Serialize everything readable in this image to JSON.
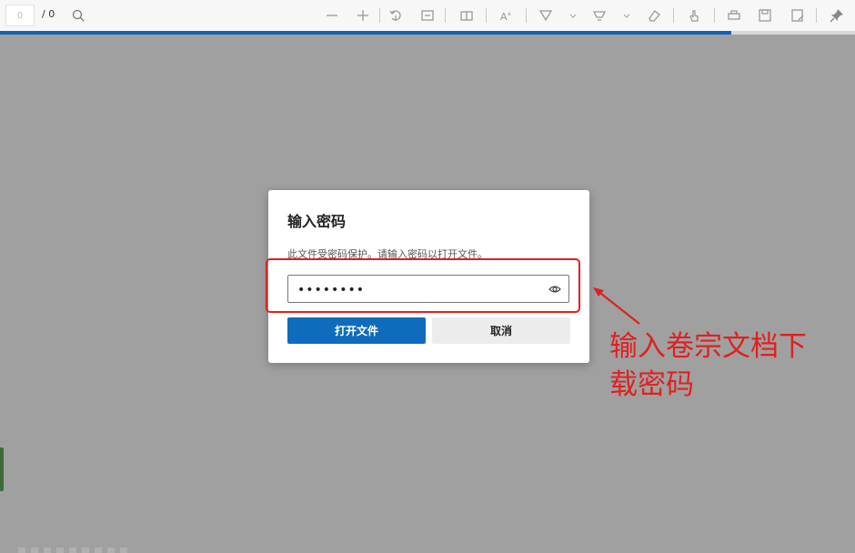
{
  "toolbar": {
    "page_input_value": "0",
    "page_total": "/ 0",
    "icons": [
      "search-icon",
      "zoom-out-icon",
      "zoom-in-icon",
      "rotate-icon",
      "fit-page-icon",
      "page-view-icon",
      "read-aloud-icon",
      "draw-icon",
      "highlight-icon",
      "erase-icon",
      "touch-icon",
      "print-icon",
      "save-icon",
      "save-as-icon",
      "pin-icon"
    ]
  },
  "load_progress_percent": 85.5,
  "dialog": {
    "title": "输入密码",
    "description": "此文件受密码保护。请输入密码以打开文件。",
    "password_value": "••••••••",
    "open_button": "打开文件",
    "cancel_button": "取消"
  },
  "annotation": {
    "text_line1": "输入卷宗文档下",
    "text_line2": "载密码"
  },
  "colors": {
    "accent": "#0f6cbd",
    "annotation_red": "#e02020",
    "backdrop": "#a0a0a0"
  }
}
